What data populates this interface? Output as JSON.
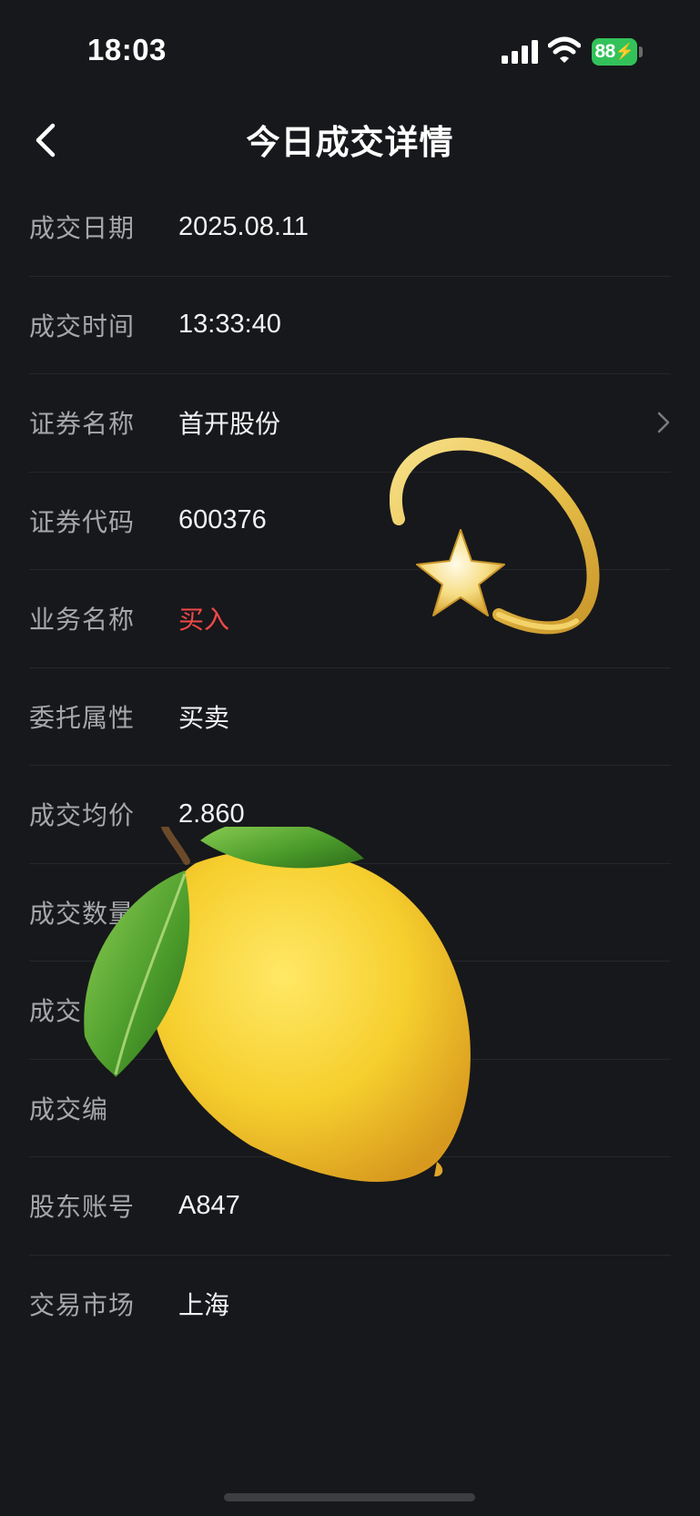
{
  "status_bar": {
    "time": "18:03",
    "battery": "88"
  },
  "nav": {
    "title": "今日成交详情"
  },
  "details": [
    {
      "label": "成交日期",
      "value": "2025.08.11"
    },
    {
      "label": "成交时间",
      "value": "13:33:40"
    },
    {
      "label": "证券名称",
      "value": "首开股份"
    },
    {
      "label": "证券代码",
      "value": "600376"
    },
    {
      "label": "业务名称",
      "value": "买入"
    },
    {
      "label": "委托属性",
      "value": "买卖"
    },
    {
      "label": "成交均价",
      "value": "2.860"
    },
    {
      "label": "成交数量",
      "value": ""
    },
    {
      "label": "成交",
      "value": ""
    },
    {
      "label": "成交编",
      "value": ""
    },
    {
      "label": "股东账号",
      "value": "A847"
    },
    {
      "label": "交易市场",
      "value": "上海"
    }
  ],
  "colors": {
    "background": "#17181b",
    "buy": "#f04848",
    "battery": "#33c25a"
  },
  "stickers": [
    "shooting-star-sticker",
    "lemon-sticker"
  ]
}
